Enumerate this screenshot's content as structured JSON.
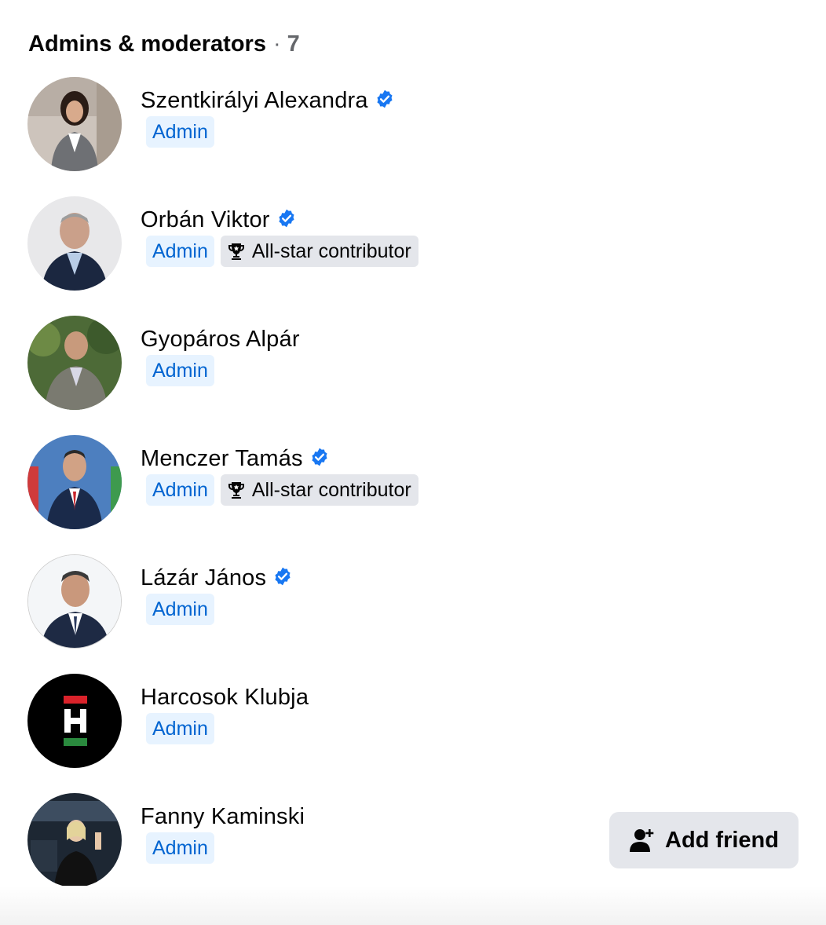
{
  "section": {
    "title": "Admins & moderators",
    "separator": "·",
    "count": "7"
  },
  "members": [
    {
      "name": "Szentkirályi Alexandra",
      "verified": true,
      "badges": [
        "Admin"
      ]
    },
    {
      "name": "Orbán Viktor",
      "verified": true,
      "badges": [
        "Admin",
        "All-star contributor"
      ]
    },
    {
      "name": "Gyopáros Alpár",
      "verified": false,
      "badges": [
        "Admin"
      ]
    },
    {
      "name": "Menczer Tamás",
      "verified": true,
      "badges": [
        "Admin",
        "All-star contributor"
      ]
    },
    {
      "name": "Lázár János",
      "verified": true,
      "badges": [
        "Admin"
      ]
    },
    {
      "name": "Harcosok Klubja",
      "verified": false,
      "badges": [
        "Admin"
      ]
    },
    {
      "name": "Fanny Kaminski",
      "verified": false,
      "badges": [
        "Admin"
      ]
    }
  ],
  "badge_labels": {
    "admin": "Admin",
    "allstar": "All-star contributor"
  },
  "icons": {
    "verified": "verified-badge-icon",
    "trophy": "trophy-icon",
    "add_friend": "add-friend-icon"
  },
  "actions": {
    "add_friend_label": "Add friend"
  },
  "colors": {
    "verified_blue": "#1877f2",
    "admin_badge_bg": "#e7f3ff",
    "admin_badge_text": "#0064d1",
    "allstar_badge_bg": "#e4e6eb",
    "button_bg": "#e4e6eb",
    "muted_text": "#65676b"
  }
}
